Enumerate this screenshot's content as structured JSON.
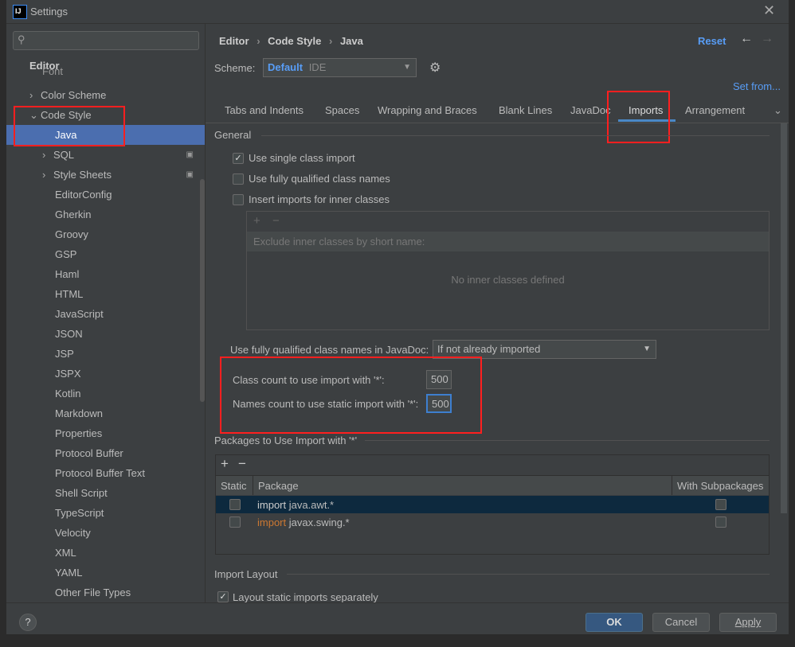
{
  "window": {
    "title": "Settings",
    "logo": "IJ"
  },
  "sidebar": {
    "search_placeholder": "",
    "section": "Editor",
    "items": [
      {
        "label": "Font",
        "level": 1
      },
      {
        "label": "Color Scheme",
        "level": 1,
        "expander": "collapsed"
      },
      {
        "label": "Code Style",
        "level": 1,
        "expander": "expanded"
      },
      {
        "label": "Java",
        "level": 2,
        "selected": true
      },
      {
        "label": "SQL",
        "level": 2,
        "expander": "collapsed",
        "badge": true
      },
      {
        "label": "Style Sheets",
        "level": 2,
        "expander": "collapsed",
        "badge": true
      },
      {
        "label": "EditorConfig",
        "level": 2
      },
      {
        "label": "Gherkin",
        "level": 2
      },
      {
        "label": "Groovy",
        "level": 2
      },
      {
        "label": "GSP",
        "level": 2
      },
      {
        "label": "Haml",
        "level": 2
      },
      {
        "label": "HTML",
        "level": 2
      },
      {
        "label": "JavaScript",
        "level": 2
      },
      {
        "label": "JSON",
        "level": 2
      },
      {
        "label": "JSP",
        "level": 2
      },
      {
        "label": "JSPX",
        "level": 2
      },
      {
        "label": "Kotlin",
        "level": 2
      },
      {
        "label": "Markdown",
        "level": 2
      },
      {
        "label": "Properties",
        "level": 2
      },
      {
        "label": "Protocol Buffer",
        "level": 2
      },
      {
        "label": "Protocol Buffer Text",
        "level": 2
      },
      {
        "label": "Shell Script",
        "level": 2
      },
      {
        "label": "TypeScript",
        "level": 2
      },
      {
        "label": "Velocity",
        "level": 2
      },
      {
        "label": "XML",
        "level": 2
      },
      {
        "label": "YAML",
        "level": 2
      },
      {
        "label": "Other File Types",
        "level": 2
      }
    ]
  },
  "breadcrumb": [
    "Editor",
    "Code Style",
    "Java"
  ],
  "header": {
    "reset": "Reset",
    "set_from": "Set from..."
  },
  "scheme": {
    "label": "Scheme:",
    "name": "Default",
    "kind": "IDE"
  },
  "tabs": [
    "Tabs and Indents",
    "Spaces",
    "Wrapping and Braces",
    "Blank Lines",
    "JavaDoc",
    "Imports",
    "Arrangement"
  ],
  "active_tab": "Imports",
  "general": {
    "title": "General",
    "use_single_class_import": {
      "label": "Use single class import",
      "checked": true
    },
    "use_fully_qualified": {
      "label": "Use fully qualified class names",
      "checked": false
    },
    "insert_inner": {
      "label": "Insert imports for inner classes",
      "checked": false
    },
    "inner_header": "Exclude inner classes by short name:",
    "inner_empty": "No inner classes defined",
    "javadoc_label": "Use fully qualified class names in JavaDoc:",
    "javadoc_value": "If not already imported",
    "class_count_label": "Class count to use import with '*':",
    "class_count": "500",
    "names_count_label": "Names count to use static import with '*':",
    "names_count": "500"
  },
  "packages": {
    "title": "Packages to Use Import with '*'",
    "columns": [
      "Static",
      "Package",
      "With Subpackages"
    ],
    "rows": [
      {
        "keyword": "import",
        "package": "java.awt.*",
        "static": false,
        "subpackages": false,
        "selected": true
      },
      {
        "keyword": "import",
        "package": "javax.swing.*",
        "static": false,
        "subpackages": false
      }
    ]
  },
  "import_layout": {
    "title": "Import Layout",
    "layout_static": {
      "label": "Layout static imports separately",
      "checked": true
    }
  },
  "footer": {
    "ok": "OK",
    "cancel": "Cancel",
    "apply": "Apply",
    "help": "?"
  },
  "colors": {
    "accent": "#4b6eaf",
    "link": "#589df6",
    "highlight": "#ff1f1f",
    "keyword": "#cc7832"
  }
}
